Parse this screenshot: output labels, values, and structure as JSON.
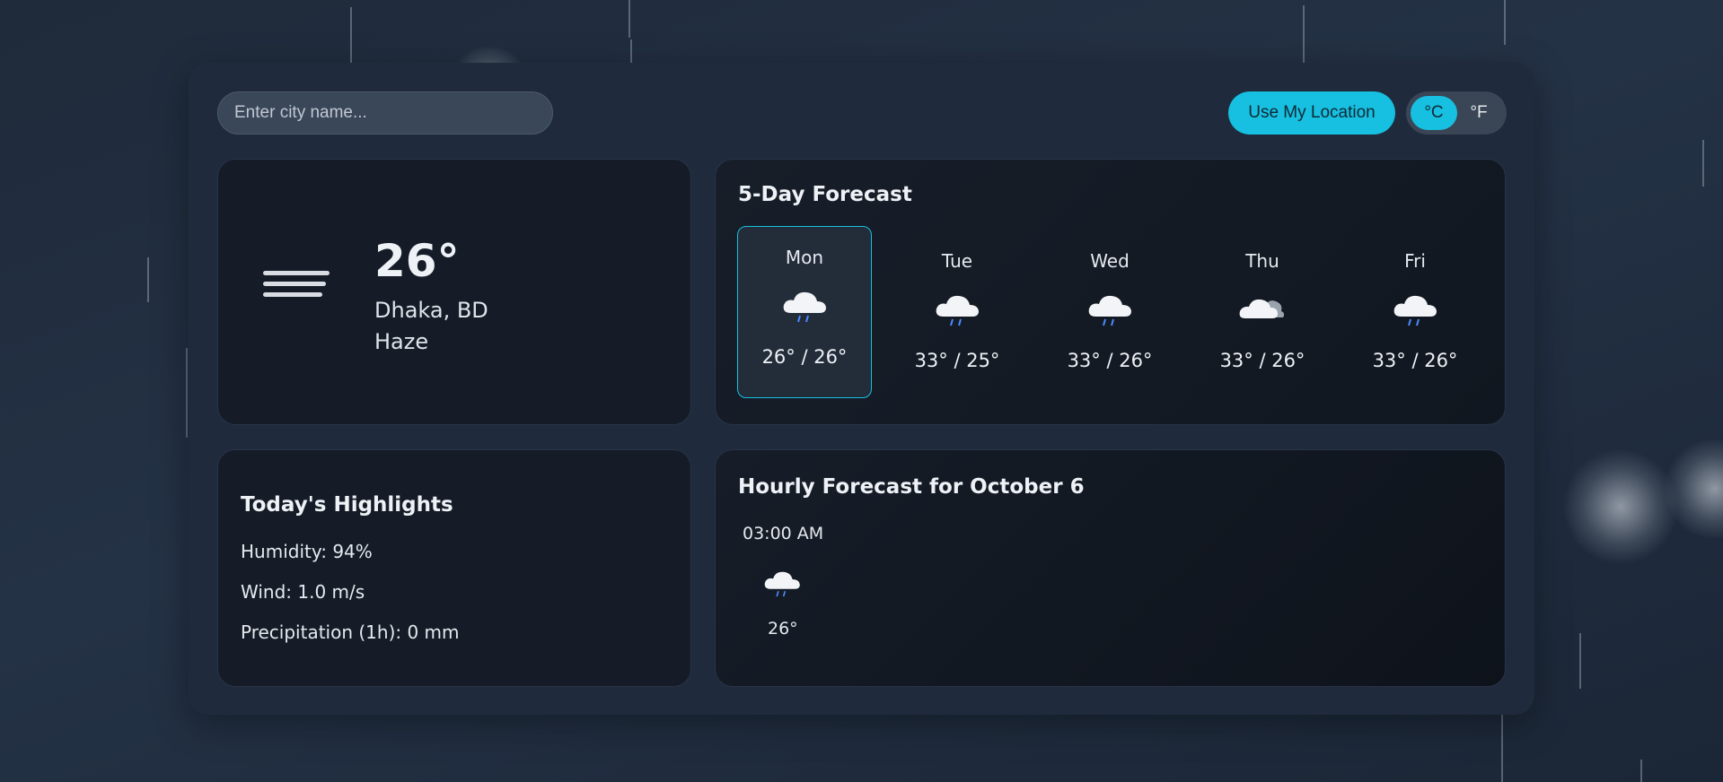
{
  "search": {
    "placeholder": "Enter city name..."
  },
  "location_button": "Use My Location",
  "units": {
    "celsius": "°C",
    "fahrenheit": "°F",
    "selected": "°C"
  },
  "current": {
    "temp": "26°",
    "city": "Dhaka, BD",
    "condition": "Haze",
    "icon": "haze-icon"
  },
  "forecast": {
    "title": "5-Day Forecast",
    "days": [
      {
        "day": "Mon",
        "temps": "26° / 26°",
        "icon": "rain-cloud-icon",
        "active": true
      },
      {
        "day": "Tue",
        "temps": "33° / 25°",
        "icon": "rain-cloud-icon"
      },
      {
        "day": "Wed",
        "temps": "33° / 26°",
        "icon": "rain-cloud-icon"
      },
      {
        "day": "Thu",
        "temps": "33° / 26°",
        "icon": "cloudy-icon"
      },
      {
        "day": "Fri",
        "temps": "33° / 26°",
        "icon": "rain-cloud-icon"
      }
    ]
  },
  "highlights": {
    "title": "Today's Highlights",
    "humidity": "Humidity: 94%",
    "wind": "Wind: 1.0 m/s",
    "precipitation": "Precipitation (1h): 0 mm"
  },
  "hourly": {
    "title": "Hourly Forecast for October 6",
    "items": [
      {
        "time": "03:00 AM",
        "temp": "26°",
        "icon": "rain-cloud-icon"
      }
    ]
  },
  "colors": {
    "accent": "#17bfe0",
    "background": "#1f2b3c",
    "card": "#151c27"
  }
}
